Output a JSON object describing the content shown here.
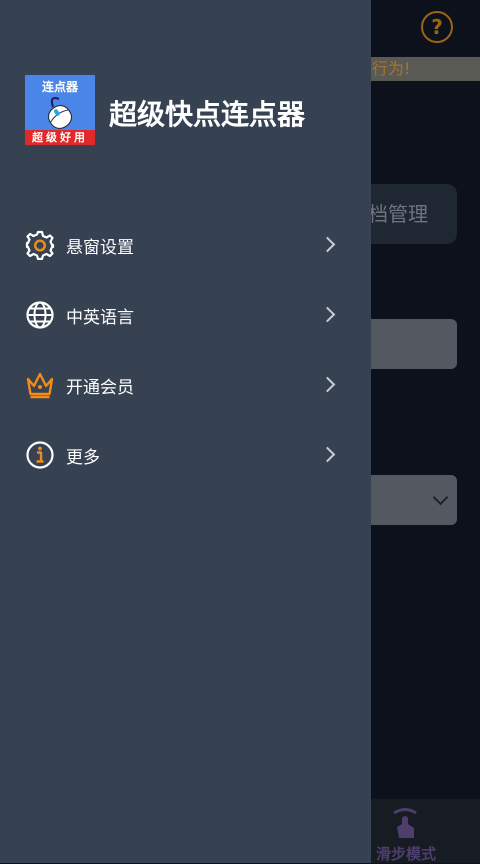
{
  "app": {
    "title": "超级快点连点器",
    "logo_top": "连点器",
    "logo_bottom": "超级好用"
  },
  "drawer": {
    "items": [
      {
        "label": "悬窗设置",
        "icon": "gear-icon"
      },
      {
        "label": "中英语言",
        "icon": "globe-icon"
      },
      {
        "label": "开通会员",
        "icon": "crown-icon"
      },
      {
        "label": "更多",
        "icon": "info-icon"
      }
    ]
  },
  "background": {
    "notice_text": "行为!",
    "card_label": "档管理",
    "bottom_tab_label": "滑步模式"
  },
  "colors": {
    "drawer_bg": "#364152",
    "accent": "#f08c1a",
    "background": "#0c111b"
  }
}
